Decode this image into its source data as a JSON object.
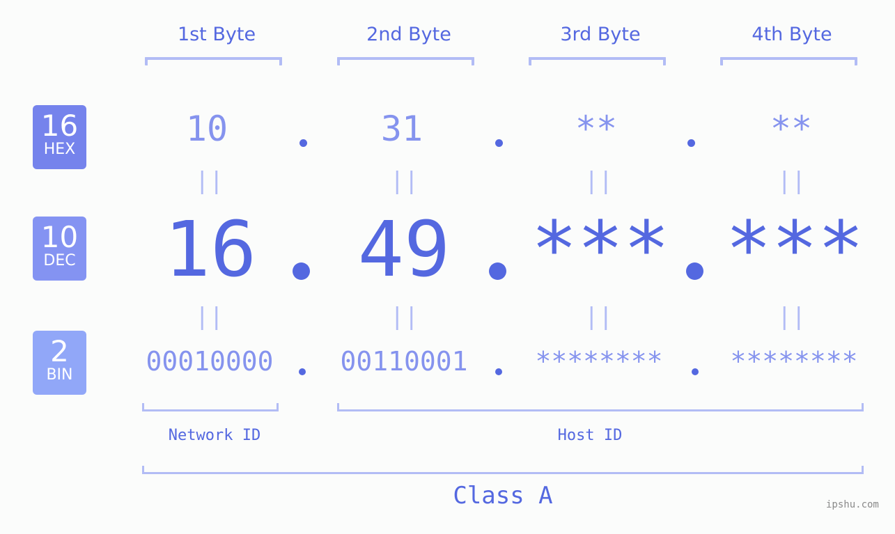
{
  "bytes": [
    {
      "header": "1st Byte",
      "hex": "10",
      "dec": "16",
      "bin": "00010000"
    },
    {
      "header": "2nd Byte",
      "hex": "31",
      "dec": "49",
      "bin": "00110001"
    },
    {
      "header": "3rd Byte",
      "hex": "**",
      "dec": "***",
      "bin": "********"
    },
    {
      "header": "4th Byte",
      "hex": "**",
      "dec": "***",
      "bin": "********"
    }
  ],
  "bases": {
    "hex": {
      "num": "16",
      "label": "HEX",
      "color": "#7583ec"
    },
    "dec": {
      "num": "10",
      "label": "DEC",
      "color": "#8493f2"
    },
    "bin": {
      "num": "2",
      "label": "BIN",
      "color": "#91a7f8"
    }
  },
  "equals_glyph": "||",
  "network_id_label": "Network ID",
  "host_id_label": "Host ID",
  "class_label": "Class A",
  "watermark": "ipshu.com",
  "colors": {
    "primary": "#5468e0",
    "light": "#8593ee",
    "bracket": "#b2bcf5"
  }
}
